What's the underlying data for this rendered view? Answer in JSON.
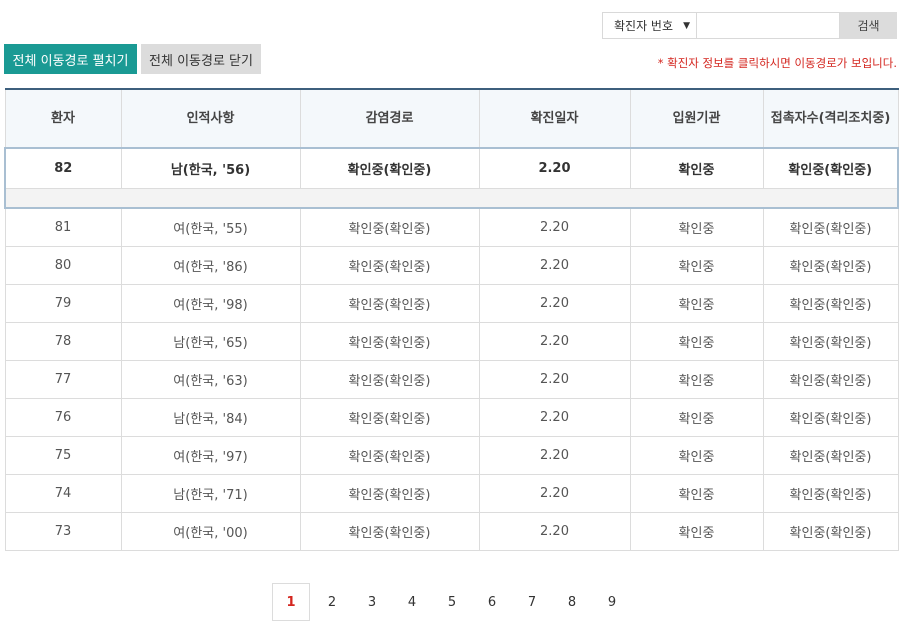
{
  "search": {
    "select_label": "확진자 번호",
    "input_value": "",
    "button_label": "검색"
  },
  "actions": {
    "expand_label": "전체 이동경로 펼치기",
    "collapse_label": "전체 이동경로 닫기"
  },
  "notice": "* 확진자 정보를 클릭하시면 이동경로가 보입니다.",
  "table": {
    "headers": [
      "환자",
      "인적사항",
      "감염경로",
      "확진일자",
      "입원기관",
      "접촉자수(격리조치중)"
    ],
    "highlight_row": [
      "82",
      "남(한국, '56)",
      "확인중(확인중)",
      "2.20",
      "확인중",
      "확인중(확인중)"
    ],
    "rows": [
      [
        "81",
        "여(한국, '55)",
        "확인중(확인중)",
        "2.20",
        "확인중",
        "확인중(확인중)"
      ],
      [
        "80",
        "여(한국, '86)",
        "확인중(확인중)",
        "2.20",
        "확인중",
        "확인중(확인중)"
      ],
      [
        "79",
        "여(한국, '98)",
        "확인중(확인중)",
        "2.20",
        "확인중",
        "확인중(확인중)"
      ],
      [
        "78",
        "남(한국, '65)",
        "확인중(확인중)",
        "2.20",
        "확인중",
        "확인중(확인중)"
      ],
      [
        "77",
        "여(한국, '63)",
        "확인중(확인중)",
        "2.20",
        "확인중",
        "확인중(확인중)"
      ],
      [
        "76",
        "남(한국, '84)",
        "확인중(확인중)",
        "2.20",
        "확인중",
        "확인중(확인중)"
      ],
      [
        "75",
        "여(한국, '97)",
        "확인중(확인중)",
        "2.20",
        "확인중",
        "확인중(확인중)"
      ],
      [
        "74",
        "남(한국, '71)",
        "확인중(확인중)",
        "2.20",
        "확인중",
        "확인중(확인중)"
      ],
      [
        "73",
        "여(한국, '00)",
        "확인중(확인중)",
        "2.20",
        "확인중",
        "확인중(확인중)"
      ]
    ]
  },
  "pagination": {
    "current": "1",
    "pages": [
      "1",
      "2",
      "3",
      "4",
      "5",
      "6",
      "7",
      "8",
      "9"
    ]
  },
  "colors": {
    "accent": "#1a9a94",
    "notice": "#d4261f",
    "header_bg": "#f4f8fb",
    "header_top_border": "#3d5f7d"
  }
}
